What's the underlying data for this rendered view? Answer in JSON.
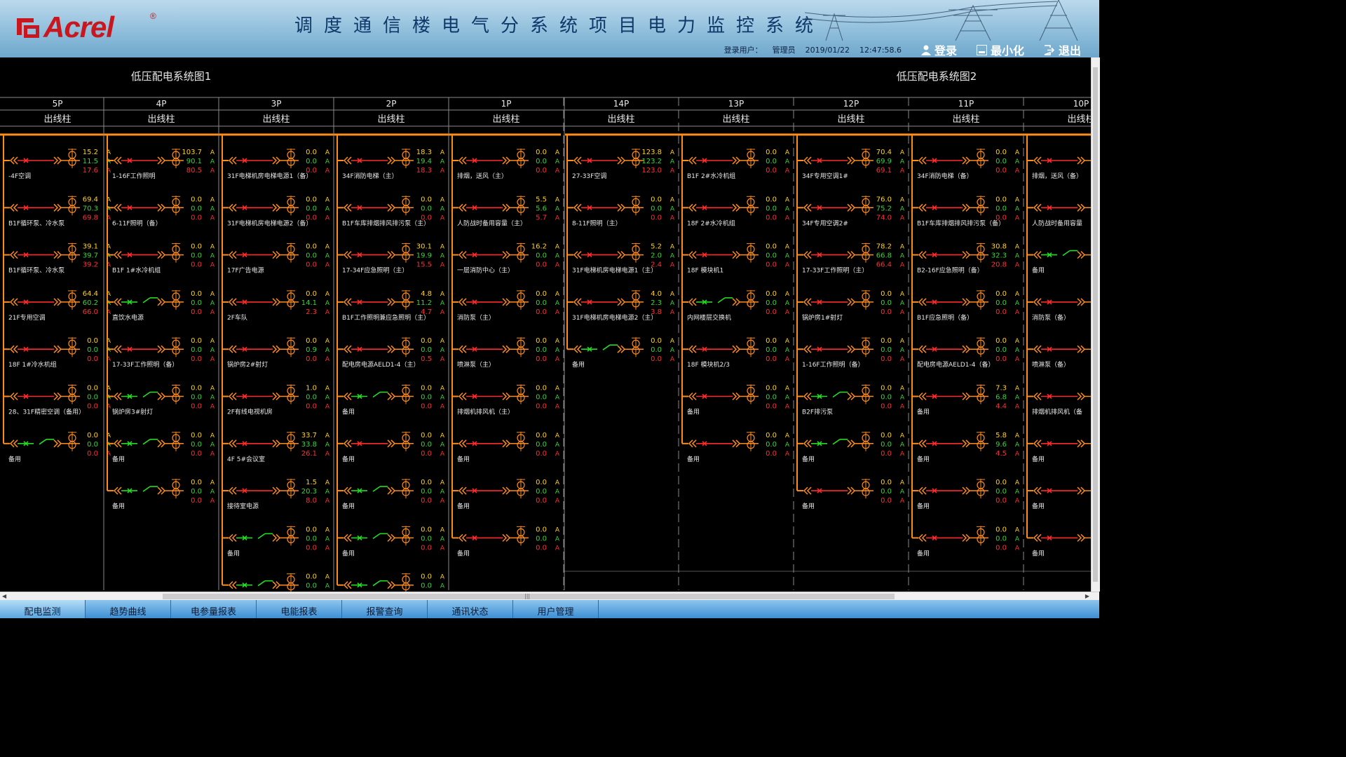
{
  "header": {
    "logo_text": "Acrel",
    "logo_reg": "®",
    "title": "调度通信楼电气分系统项目电力监控系统",
    "login_label": "登录用户：",
    "user": "管理员",
    "date": "2019/01/22",
    "time": "12:47:58.6",
    "buttons": [
      "登录",
      "最小化",
      "退出"
    ]
  },
  "diagram": {
    "title_left": "低压配电系统图1",
    "title_right": "低压配电系统图2",
    "unit": "A",
    "panels": [
      {
        "name": "5P",
        "type": "出线柱",
        "circuits": [
          {
            "label": "-4F空调",
            "v": [
              "15.2",
              "11.5",
              "17.6"
            ],
            "on": true
          },
          {
            "label": "B1F循环泵、冷水泵",
            "v": [
              "69.4",
              "70.3",
              "69.8"
            ],
            "on": true
          },
          {
            "label": "B1F循环泵、冷水泵",
            "v": [
              "39.1",
              "39.7",
              "39.2"
            ],
            "on": true
          },
          {
            "label": "21F专用空调",
            "v": [
              "64.4",
              "60.2",
              "66.0"
            ],
            "on": true
          },
          {
            "label": "18F 1#冷水机组",
            "v": [
              "0.0",
              "0.0",
              "0.0"
            ],
            "on": true
          },
          {
            "label": "28、31F精密空调（备用）",
            "v": [
              "0.0",
              "0.0",
              "0.0"
            ],
            "on": true
          },
          {
            "label": "备用",
            "v": [
              "0.0",
              "0.0",
              "0.0"
            ],
            "on": false
          }
        ]
      },
      {
        "name": "4P",
        "type": "出线柱",
        "circuits": [
          {
            "label": "1-16F工作照明",
            "v": [
              "103.7",
              "90.1",
              "80.5"
            ],
            "on": true
          },
          {
            "label": "6-11F照明（备）",
            "v": [
              "0.0",
              "0.0",
              "0.0"
            ],
            "on": true
          },
          {
            "label": "B1F 1#水冷机组",
            "v": [
              "0.0",
              "0.0",
              "0.0"
            ],
            "on": true
          },
          {
            "label": "直饮水电源",
            "v": [
              "0.0",
              "0.0",
              "0.0"
            ],
            "on": false
          },
          {
            "label": "17-33F工作照明（备）",
            "v": [
              "0.0",
              "0.0",
              "0.0"
            ],
            "on": true
          },
          {
            "label": "锅炉房3#射灯",
            "v": [
              "0.0",
              "0.0",
              "0.0"
            ],
            "on": false
          },
          {
            "label": "备用",
            "v": [
              "0.0",
              "0.0",
              "0.0"
            ],
            "on": false
          },
          {
            "label": "备用",
            "v": [
              "0.0",
              "0.0",
              "0.0"
            ],
            "on": false
          }
        ]
      },
      {
        "name": "3P",
        "type": "出线柱",
        "circuits": [
          {
            "label": "31F电梯机房电梯电源1（备）",
            "v": [
              "0.0",
              "0.0",
              "0.0"
            ],
            "on": true
          },
          {
            "label": "31F电梯机房电梯电源2（备）",
            "v": [
              "0.0",
              "0.0",
              "0.0"
            ],
            "on": true
          },
          {
            "label": "17F广告电源",
            "v": [
              "0.0",
              "0.0",
              "0.0"
            ],
            "on": true
          },
          {
            "label": "2F车队",
            "v": [
              "0.0",
              "14.1",
              "2.3"
            ],
            "on": true
          },
          {
            "label": "锅炉房2#射灯",
            "v": [
              "0.0",
              "0.9",
              "0.0"
            ],
            "on": true
          },
          {
            "label": "2F有线电视机房",
            "v": [
              "1.0",
              "0.0",
              "0.0"
            ],
            "on": true
          },
          {
            "label": "4F 5#会议室",
            "v": [
              "33.7",
              "33.8",
              "26.1"
            ],
            "on": true
          },
          {
            "label": "接待室电源",
            "v": [
              "1.5",
              "20.3",
              "8.0"
            ],
            "on": true
          },
          {
            "label": "备用",
            "v": [
              "0.0",
              "0.0",
              "0.0"
            ],
            "on": false
          },
          {
            "label": "",
            "v": [
              "0.0",
              "0.0",
              "0.0"
            ],
            "on": false
          }
        ]
      },
      {
        "name": "2P",
        "type": "出线柱",
        "circuits": [
          {
            "label": "34F消防电梯（主）",
            "v": [
              "18.3",
              "19.4",
              "18.3"
            ],
            "on": true
          },
          {
            "label": "B1F车库排烟排风排污泵（主）",
            "v": [
              "0.0",
              "0.0",
              "0.0"
            ],
            "on": true
          },
          {
            "label": "17-34F应急照明（主）",
            "v": [
              "30.1",
              "19.9",
              "15.5"
            ],
            "on": true
          },
          {
            "label": "B1F工作照明兼应急照明（主）",
            "v": [
              "4.8",
              "11.2",
              "4.7"
            ],
            "on": true
          },
          {
            "label": "配电房电源AELD1-4（主）",
            "v": [
              "0.0",
              "0.0",
              "0.5"
            ],
            "on": true
          },
          {
            "label": "备用",
            "v": [
              "0.0",
              "0.0",
              "0.0"
            ],
            "on": false
          },
          {
            "label": "备用",
            "v": [
              "0.0",
              "0.0",
              "0.0"
            ],
            "on": true
          },
          {
            "label": "备用",
            "v": [
              "0.0",
              "0.0",
              "0.0"
            ],
            "on": false
          },
          {
            "label": "备用",
            "v": [
              "0.0",
              "0.0",
              "0.0"
            ],
            "on": false
          },
          {
            "label": "",
            "v": [
              "0.0",
              "0.0",
              "0.0"
            ],
            "on": false
          }
        ]
      },
      {
        "name": "1P",
        "type": "出线柱",
        "circuits": [
          {
            "label": "排烟，送风（主）",
            "v": [
              "0.0",
              "0.0",
              "0.0"
            ],
            "on": true
          },
          {
            "label": "人防战时备用容量（主）",
            "v": [
              "5.5",
              "5.6",
              "5.7"
            ],
            "on": true
          },
          {
            "label": "一层消防中心（主）",
            "v": [
              "16.2",
              "0.0",
              "0.0"
            ],
            "on": true
          },
          {
            "label": "消防泵（主）",
            "v": [
              "0.0",
              "0.0",
              "0.0"
            ],
            "on": true
          },
          {
            "label": "喷淋泵（主）",
            "v": [
              "0.0",
              "0.0",
              "0.0"
            ],
            "on": true
          },
          {
            "label": "排烟机排风机（主）",
            "v": [
              "0.0",
              "0.0",
              "0.0"
            ],
            "on": true
          },
          {
            "label": "备用",
            "v": [
              "0.0",
              "0.0",
              "0.0"
            ],
            "on": true
          },
          {
            "label": "备用",
            "v": [
              "0.0",
              "0.0",
              "0.0"
            ],
            "on": true
          },
          {
            "label": "备用",
            "v": [
              "0.0",
              "0.0",
              "0.0"
            ],
            "on": true
          }
        ]
      },
      {
        "name": "14P",
        "type": "出线柱",
        "circuits": [
          {
            "label": "27-33F空调",
            "v": [
              "123.8",
              "123.2",
              "123.0"
            ],
            "on": true
          },
          {
            "label": "8-11F照明（主）",
            "v": [
              "0.0",
              "0.0",
              "0.0"
            ],
            "on": true
          },
          {
            "label": "31F电梯机房电梯电源1（主）",
            "v": [
              "5.2",
              "2.0",
              "2.4"
            ],
            "on": true
          },
          {
            "label": "31F电梯机房电梯电源2（主）",
            "v": [
              "4.0",
              "2.3",
              "3.8"
            ],
            "on": true
          },
          {
            "label": "备用",
            "v": [
              "0.0",
              "0.0",
              "0.0"
            ],
            "on": false
          }
        ]
      },
      {
        "name": "13P",
        "type": "出线柱",
        "circuits": [
          {
            "label": "B1F 2#水冷机组",
            "v": [
              "0.0",
              "0.0",
              "0.0"
            ],
            "on": true
          },
          {
            "label": "18F 2#水冷机组",
            "v": [
              "0.0",
              "0.0",
              "0.0"
            ],
            "on": true
          },
          {
            "label": "18F 模块机1",
            "v": [
              "0.0",
              "0.0",
              "0.0"
            ],
            "on": true
          },
          {
            "label": "内网楼层交换机",
            "v": [
              "0.0",
              "0.0",
              "0.0"
            ],
            "on": false
          },
          {
            "label": "18F 模块机2/3",
            "v": [
              "0.0",
              "0.0",
              "0.0"
            ],
            "on": true
          },
          {
            "label": "备用",
            "v": [
              "0.0",
              "0.0",
              "0.0"
            ],
            "on": true
          },
          {
            "label": "备用",
            "v": [
              "0.0",
              "0.0",
              "0.0"
            ],
            "on": true
          }
        ]
      },
      {
        "name": "12P",
        "type": "出线柱",
        "circuits": [
          {
            "label": "34F专用空调1#",
            "v": [
              "70.4",
              "69.9",
              "69.1"
            ],
            "on": true
          },
          {
            "label": "34F专用空调2#",
            "v": [
              "76.0",
              "75.2",
              "74.0"
            ],
            "on": true
          },
          {
            "label": "17-33F工作照明（主）",
            "v": [
              "78.2",
              "66.8",
              "66.4"
            ],
            "on": true
          },
          {
            "label": "锅炉房1#射灯",
            "v": [
              "0.0",
              "0.0",
              "0.0"
            ],
            "on": true
          },
          {
            "label": "1-16F工作照明（备）",
            "v": [
              "0.0",
              "0.0",
              "0.0"
            ],
            "on": true
          },
          {
            "label": "B2F排污泵",
            "v": [
              "0.0",
              "0.0",
              "0.0"
            ],
            "on": false
          },
          {
            "label": "备用",
            "v": [
              "0.0",
              "0.0",
              "0.0"
            ],
            "on": false
          },
          {
            "label": "备用",
            "v": [
              "0.0",
              "0.0",
              "0.0"
            ],
            "on": true
          }
        ]
      },
      {
        "name": "11P",
        "type": "出线柱",
        "circuits": [
          {
            "label": "34F消防电梯（备）",
            "v": [
              "0.0",
              "0.0",
              "0.0"
            ],
            "on": true
          },
          {
            "label": "B1F车库排烟排风排污泵（备）",
            "v": [
              "0.0",
              "0.0",
              "0.0"
            ],
            "on": true
          },
          {
            "label": "B2-16F应急照明（备）",
            "v": [
              "30.8",
              "32.3",
              "20.8"
            ],
            "on": true
          },
          {
            "label": "B1F应急照明（备）",
            "v": [
              "0.0",
              "0.0",
              "0.0"
            ],
            "on": true
          },
          {
            "label": "配电房电源AELD1-4（备）",
            "v": [
              "0.0",
              "0.0",
              "0.0"
            ],
            "on": true
          },
          {
            "label": "备用",
            "v": [
              "7.3",
              "6.8",
              "4.4"
            ],
            "on": true
          },
          {
            "label": "备用",
            "v": [
              "5.8",
              "9.6",
              "4.5"
            ],
            "on": true
          },
          {
            "label": "备用",
            "v": [
              "0.0",
              "0.0",
              "0.0"
            ],
            "on": true
          },
          {
            "label": "备用",
            "v": [
              "0.0",
              "0.0",
              "0.0"
            ],
            "on": true
          }
        ]
      },
      {
        "name": "10P",
        "type": "出线柱",
        "circuits": [
          {
            "label": "排烟，送风（备）",
            "v": [
              "",
              "",
              ""
            ],
            "on": true
          },
          {
            "label": "人防战时备用容量",
            "v": [
              "",
              "",
              ""
            ],
            "on": true
          },
          {
            "label": "备用",
            "v": [
              "",
              "",
              ""
            ],
            "on": false
          },
          {
            "label": "消防泵（备）",
            "v": [
              "",
              "",
              ""
            ],
            "on": true
          },
          {
            "label": "喷淋泵（备）",
            "v": [
              "",
              "",
              ""
            ],
            "on": true
          },
          {
            "label": "排烟机排风机（备",
            "v": [
              "",
              "",
              ""
            ],
            "on": true
          },
          {
            "label": "备用",
            "v": [
              "",
              "",
              ""
            ],
            "on": true
          },
          {
            "label": "备用",
            "v": [
              "",
              "",
              ""
            ],
            "on": true
          },
          {
            "label": "备用",
            "v": [
              "",
              "",
              ""
            ],
            "on": true
          }
        ]
      }
    ]
  },
  "tabs": [
    "配电监测",
    "趋势曲线",
    "电参量报表",
    "电能报表",
    "报警查询",
    "通讯状态",
    "用户管理"
  ],
  "colors": {
    "bus": "#ff8c1a",
    "closed": "#ff2a2a",
    "open": "#22dd22",
    "phaseA": "#ffd21f",
    "phaseB": "#3bd43b",
    "phaseC": "#ff3030",
    "text": "#e8e8e8",
    "grid": "#8a8a8a"
  }
}
